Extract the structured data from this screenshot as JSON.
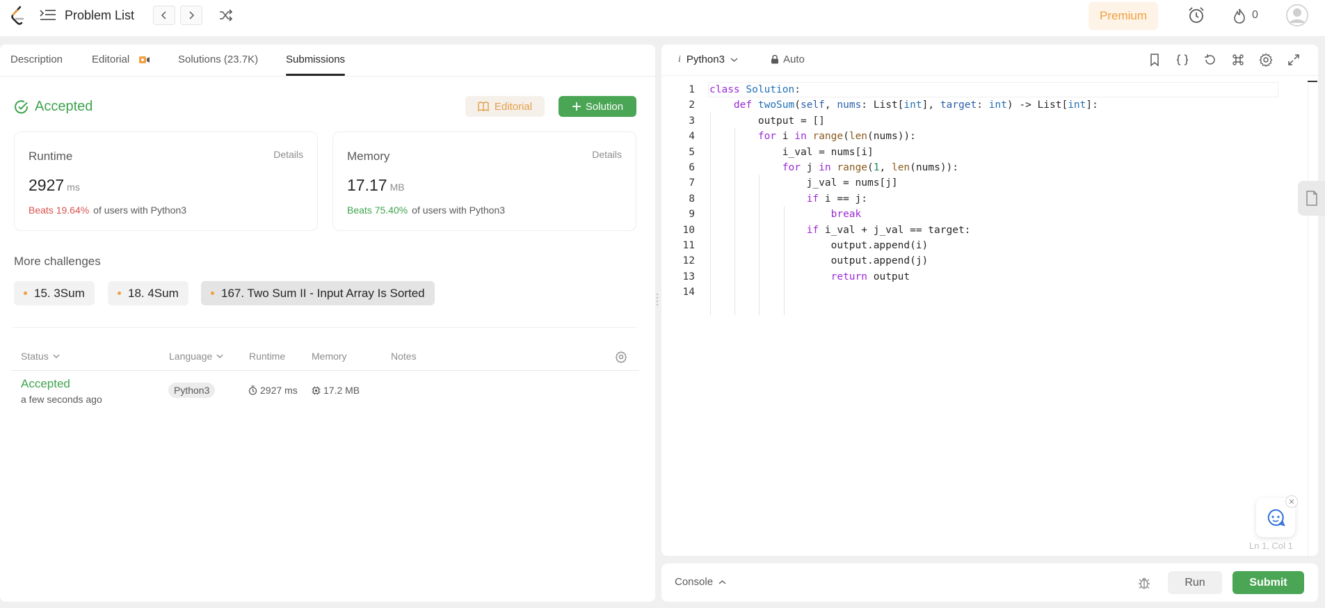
{
  "header": {
    "problem_list_label": "Problem List",
    "premium_label": "Premium",
    "streak_count": "0",
    "colors": {
      "premium_bg": "#fdf3e7",
      "premium_text": "#f0a040"
    }
  },
  "left_tabs": [
    {
      "label": "Description"
    },
    {
      "label": "Editorial"
    },
    {
      "label": "Solutions (23.7K)"
    },
    {
      "label": "Submissions"
    }
  ],
  "result": {
    "status": "Accepted",
    "editorial_button": "Editorial",
    "solution_button": "Solution",
    "runtime": {
      "title": "Runtime",
      "details": "Details",
      "value": "2927",
      "unit": "ms",
      "beats": "Beats 19.64%",
      "beats_suffix": "of users with Python3"
    },
    "memory": {
      "title": "Memory",
      "details": "Details",
      "value": "17.17",
      "unit": "MB",
      "beats": "Beats 75.40%",
      "beats_suffix": "of users with Python3"
    }
  },
  "more_challenges": {
    "title": "More challenges",
    "items": [
      {
        "label": "15. 3Sum"
      },
      {
        "label": "18. 4Sum"
      },
      {
        "label": "167. Two Sum II - Input Array Is Sorted"
      }
    ]
  },
  "submissions_table": {
    "headers": {
      "status": "Status",
      "language": "Language",
      "runtime": "Runtime",
      "memory": "Memory",
      "notes": "Notes"
    },
    "rows": [
      {
        "status": "Accepted",
        "time": "a few seconds ago",
        "language": "Python3",
        "runtime": "2927 ms",
        "memory": "17.2 MB"
      }
    ]
  },
  "editor": {
    "language": "Python3",
    "language_marker": "i",
    "auto_label": "Auto",
    "cursor_position": "Ln 1, Col 1",
    "line_numbers": [
      "1",
      "2",
      "3",
      "4",
      "5",
      "6",
      "7",
      "8",
      "9",
      "10",
      "11",
      "12",
      "13",
      "14"
    ],
    "code_lines": [
      "class Solution:",
      "    def twoSum(self, nums: List[int], target: int) -> List[int]:",
      "        output = []",
      "        for i in range(len(nums)):",
      "            i_val = nums[i]",
      "            for j in range(1, len(nums)):",
      "                j_val = nums[j]",
      "                if i == j:",
      "                    break",
      "                if i_val + j_val == target:",
      "                    output.append(i)",
      "                    output.append(j)",
      "                    return output",
      ""
    ]
  },
  "console": {
    "label": "Console",
    "run_label": "Run",
    "submit_label": "Submit",
    "colors": {
      "submit_bg": "#4aa555",
      "accepted": "#3ea34e"
    }
  }
}
